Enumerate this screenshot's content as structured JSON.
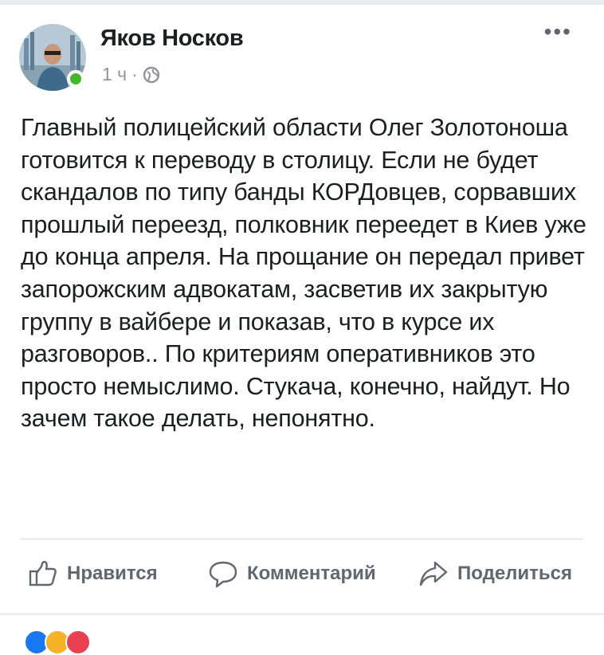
{
  "post": {
    "author": "Яков Носков",
    "time": "1 ч",
    "separator": "·",
    "more_label": "•••",
    "text": "Главный полицейский области Олег Золотоноша готовится к переводу в столицу. Если не будет скандалов по типу банды КОРДовцев, сорвавших прошлый переезд, полковник переедет в Киев уже до конца апреля. На прощание он передал привет запорожским адвокатам, засветив их закрытую группу в вайбере и показав, что в курсе их разговоров.. По критериям оперативников это просто немыслимо. Стукача, конечно, найдут. Но зачем такое делать, непонятно."
  },
  "actions": {
    "like": "Нравится",
    "comment": "Комментарий",
    "share": "Поделиться"
  },
  "icons": {
    "visibility": "globe-icon",
    "like": "thumbs-up-icon",
    "comment": "speech-bubble-icon",
    "share": "share-arrow-icon"
  },
  "colors": {
    "text": "#1c1e21",
    "secondary": "#606770",
    "online": "#42b72a",
    "divider": "#dadde1"
  }
}
